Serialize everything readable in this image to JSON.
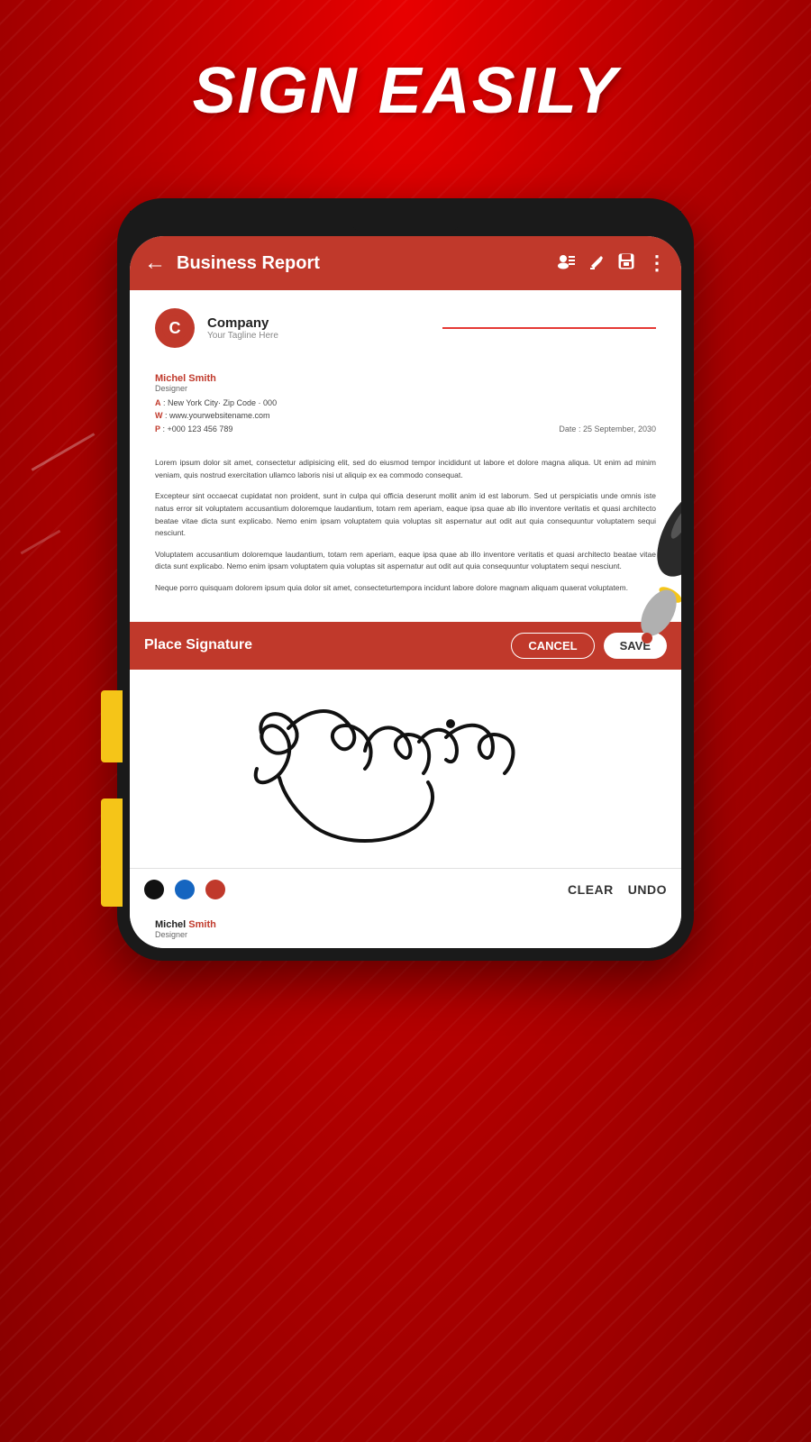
{
  "hero": {
    "title": "SIGN EASILY"
  },
  "toolbar": {
    "title": "Business Report",
    "back_icon": "←",
    "contacts_icon": "👥",
    "edit_icon": "✏",
    "save_icon": "💾",
    "more_icon": "⋮"
  },
  "document": {
    "company_initial": "C",
    "company_name": "Company",
    "company_tagline": "Your Tagline Here",
    "contact_first": "Michel",
    "contact_last": "Smith",
    "contact_role": "Designer",
    "address_label": "A",
    "address_value": ": New York City· Zip Code · 000",
    "website_label": "W",
    "website_value": ": www.yourwebsitename.com",
    "phone_label": "P",
    "phone_value": ": +000 123 456 789",
    "date_label": "Date",
    "date_value": ": 25 September, 2030",
    "paragraph1": "Lorem ipsum dolor sit amet, consectetur adipisicing elit, sed do eiusmod tempor incididunt ut labore et dolore magna aliqua. Ut enim ad minim veniam, quis nostrud exercitation ullamco laboris nisi ut aliquip ex ea commodo consequat.",
    "paragraph2": "Excepteur sint occaecat cupidatat non proident, sunt in culpa qui officia deserunt mollit anim id est laborum. Sed ut perspiciatis unde omnis iste natus error sit voluptatem accusantium doloremque laudantium, totam rem aperiam, eaque ipsa quae ab illo inventore veritatis et quasi architecto beatae vitae dicta sunt explicabo. Nemo enim ipsam voluptatem quia voluptas sit aspernatur aut odit aut quia consequuntur voluptatem sequi nesciunt.",
    "paragraph3": "Voluptatem accusantium doloremque laudantium, totam rem aperiam, eaque ipsa quae ab illo inventore veritatis et quasi architecto beatae vitae dicta sunt explicabo. Nemo enim ipsam voluptatem quia voluptas sit aspernatur aut odit aut quia consequuntur voluptatem sequi nesciunt.",
    "paragraph4": "Neque porro quisquam dolorem ipsum quia dolor sit amet, consecteturtempora incidunt labore dolore magnam aliquam quaerat voluptatem."
  },
  "signature_panel": {
    "title": "Place Signature",
    "cancel_label": "CANCEL",
    "save_label": "SAVE",
    "signature_text": "Selina",
    "clear_label": "CLEAR",
    "undo_label": "UNDO",
    "colors": {
      "black": "#111111",
      "blue": "#1565c0",
      "red": "#c0392b"
    }
  },
  "bottom_strip": {
    "contact_first": "Michel",
    "contact_last": "Smith",
    "contact_role": "Designer"
  }
}
